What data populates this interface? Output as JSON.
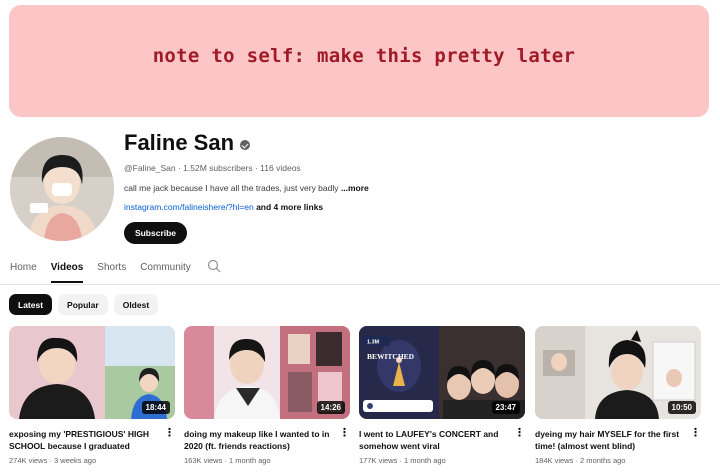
{
  "banner": {
    "text": "note to self:  make this pretty later"
  },
  "channel": {
    "name": "Faline San",
    "meta": "@Faline_San · 1.52M subscribers · 116 videos",
    "description": "call me jack because I have all the trades, just very badly ",
    "description_more": "...more",
    "link": "instagram.com/falineishere/?hl=en",
    "more_links": " and 4 more links",
    "subscribe_label": "Subscribe"
  },
  "tabs": [
    {
      "label": "Home",
      "active": false
    },
    {
      "label": "Videos",
      "active": true
    },
    {
      "label": "Shorts",
      "active": false
    },
    {
      "label": "Community",
      "active": false
    }
  ],
  "chips": [
    {
      "label": "Latest",
      "active": true
    },
    {
      "label": "Popular",
      "active": false
    },
    {
      "label": "Oldest",
      "active": false
    }
  ],
  "videos": [
    {
      "title": "exposing my 'PRESTIGIOUS' HIGH SCHOOL because I graduated",
      "meta": "274K views · 3 weeks ago",
      "duration": "18:44"
    },
    {
      "title": "doing my makeup like I wanted to in 2020 (ft. friends reactions)",
      "meta": "163K views · 1 month ago",
      "duration": "14:26"
    },
    {
      "title": "I went to LAUFEY's CONCERT and somehow went viral",
      "meta": "177K views · 1 month ago",
      "duration": "23:47"
    },
    {
      "title": "dyeing my hair MYSELF for the first time! (almost went blind)",
      "meta": "184K views · 2 months ago",
      "duration": "10:50"
    }
  ],
  "thumbnail_text": {
    "concert_title": "BEWITCHED",
    "concert_views": "1.3M"
  }
}
